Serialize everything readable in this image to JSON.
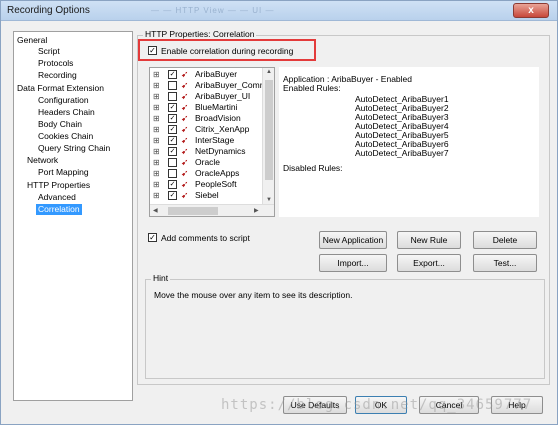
{
  "window": {
    "title": "Recording Options",
    "ghost_title": "— — HTTP View — — UI —",
    "close_label": "x"
  },
  "tree": {
    "items": [
      {
        "label": "General",
        "level": 0
      },
      {
        "label": "Script",
        "level": 1
      },
      {
        "label": "Protocols",
        "level": 1
      },
      {
        "label": "Recording",
        "level": 1
      },
      {
        "label": "Data Format Extension",
        "level": 0
      },
      {
        "label": "Configuration",
        "level": 1
      },
      {
        "label": "Headers Chain",
        "level": 1
      },
      {
        "label": "Body Chain",
        "level": 1
      },
      {
        "label": "Cookies Chain",
        "level": 1
      },
      {
        "label": "Query String Chain",
        "level": 1
      },
      {
        "label": "Network",
        "level": 0
      },
      {
        "label": "Port Mapping",
        "level": 1
      },
      {
        "label": "HTTP Properties",
        "level": 0
      },
      {
        "label": "Advanced",
        "level": 1
      },
      {
        "label": "Correlation",
        "level": 1,
        "selected": true
      }
    ]
  },
  "panel": {
    "group_title": "HTTP Properties: Correlation",
    "enable_correlation": {
      "label": "Enable correlation during recording",
      "checked": true
    },
    "add_comments": {
      "label": "Add comments to script",
      "checked": true
    }
  },
  "apps": [
    {
      "label": "AribaBuyer",
      "checked": true
    },
    {
      "label": "AribaBuyer_Comm",
      "checked": false
    },
    {
      "label": "AribaBuyer_UI",
      "checked": false
    },
    {
      "label": "BlueMartini",
      "checked": true
    },
    {
      "label": "BroadVision",
      "checked": true
    },
    {
      "label": "Citrix_XenApp",
      "checked": true
    },
    {
      "label": "InterStage",
      "checked": true
    },
    {
      "label": "NetDynamics",
      "checked": true
    },
    {
      "label": "Oracle",
      "checked": false
    },
    {
      "label": "OracleApps",
      "checked": false
    },
    {
      "label": "PeopleSoft",
      "checked": true
    },
    {
      "label": "Siebel",
      "checked": true
    }
  ],
  "info": {
    "application": "Application : AribaBuyer - Enabled",
    "enabled_rules_label": "Enabled Rules:",
    "rules": [
      "AutoDetect_AribaBuyer1",
      "AutoDetect_AribaBuyer2",
      "AutoDetect_AribaBuyer3",
      "AutoDetect_AribaBuyer4",
      "AutoDetect_AribaBuyer5",
      "AutoDetect_AribaBuyer6",
      "AutoDetect_AribaBuyer7"
    ],
    "disabled_rules_label": "Disabled Rules:"
  },
  "buttons": {
    "new_application": "New Application",
    "new_rule": "New Rule",
    "delete": "Delete",
    "import": "Import...",
    "export": "Export...",
    "test": "Test...",
    "use_defaults": "Use Defaults",
    "ok": "OK",
    "cancel": "Cancel",
    "help": "Help"
  },
  "hint": {
    "title": "Hint",
    "text": "Move the mouse over any item to see its description."
  },
  "watermark": "https://blog.csdn.net/qq_34659777",
  "icons": {
    "expand": "plus-box",
    "app": "red-arrow-icon",
    "check": "checkmark"
  },
  "colors": {
    "selection": "#3399ff",
    "highlight_border": "#e33b3b",
    "title_gradient_top": "#cfe1f5"
  }
}
